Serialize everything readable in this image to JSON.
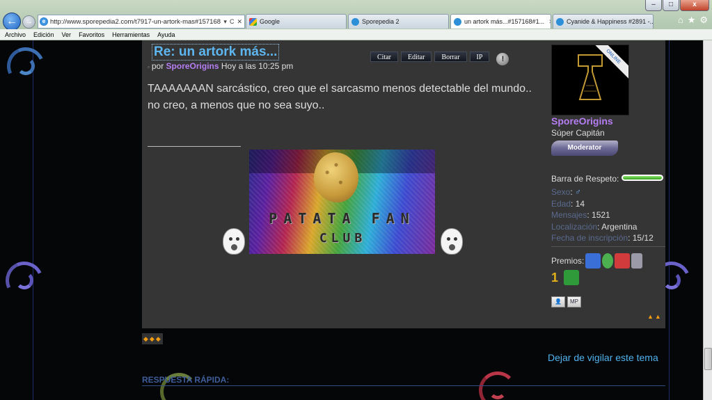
{
  "browser": {
    "address": "http://www.sporepedia2.com/t7917-un-artork-mas#157168",
    "address_tools": [
      "▾",
      "C",
      "✕"
    ],
    "tabs": [
      {
        "label": "Google",
        "favicon_color": "#3b7de0"
      },
      {
        "label": "Sporepedia 2",
        "favicon_color": "#2d8fd8"
      },
      {
        "label": "un artork más...#157168#1...",
        "favicon_color": "#2d8fd8",
        "active": true
      },
      {
        "label": "Cyanide & Happiness #2891 -...",
        "favicon_color": "#2d8fd8"
      }
    ],
    "menu": [
      "Archivo",
      "Edición",
      "Ver",
      "Favoritos",
      "Herramientas",
      "Ayuda"
    ],
    "window_controls": [
      "–",
      "□",
      "x"
    ],
    "right_icons": [
      "home-icon",
      "star-icon",
      "gear-icon"
    ]
  },
  "post": {
    "title": "Re: un artork más...",
    "meta_prefix": "por",
    "author": "SporeOrigins",
    "time": "Hoy a las 10:25 pm",
    "actions": [
      "Citar",
      "Editar",
      "Borrar",
      "IP"
    ],
    "body": "TAAAAAAAN sarcástico, creo que el sarcasmo menos detectable del mundo.. no creo, a menos que no sea suyo..",
    "signature": {
      "line1": "PATATA FAN",
      "line2": "CLUB"
    }
  },
  "profile": {
    "ribbon": "ONLINE",
    "name": "SporeOrigins",
    "rank": "Súper Capitán",
    "badge": "Moderator",
    "respect_label": "Barra de Respeto:",
    "respect_fraction": 1.0,
    "fields": [
      {
        "key": "Sexo",
        "value": "♂"
      },
      {
        "key": "Edad",
        "value": "14"
      },
      {
        "key": "Mensajes",
        "value": "1521"
      },
      {
        "key": "Localización",
        "value": "Argentina"
      },
      {
        "key": "Fecha de inscripción",
        "value": "15/12"
      }
    ],
    "awards_label": "Premios:",
    "award_colors": [
      "#3b6fd8",
      "#4caf50",
      "#d23b3b",
      "#9a9aa8",
      "#e3b21a",
      "#2e9a3a"
    ],
    "award_special": "1",
    "profile_buttons": [
      "profile-icon",
      "mp-icon"
    ]
  },
  "footer": {
    "unwatch": "Dejar de vigilar este tema",
    "quick_reply": "RESPUESTA RÁPIDA:"
  },
  "colors": {
    "link": "#4fb3ee",
    "username": "#b57ef2",
    "post_bg": "#353535"
  }
}
